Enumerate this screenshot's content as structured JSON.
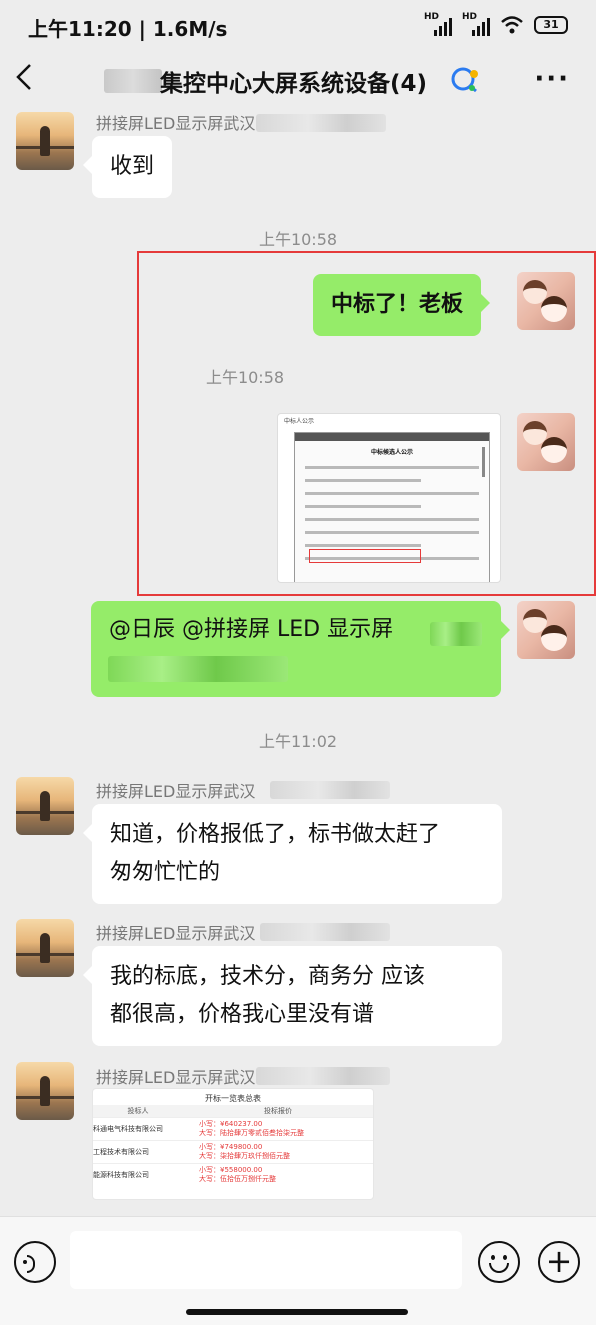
{
  "status_bar": {
    "time": "上午11:20 | 1.6M/s",
    "hd1": "HD",
    "hd2": "HD",
    "battery": "31"
  },
  "header": {
    "title": "集控中心大屏系统设备(4)",
    "back_icon": "back-arrow-icon",
    "more_icon": "more-dots-icon"
  },
  "messages": [
    {
      "type": "text",
      "direction": "in",
      "sender": "拼接屏LED显示屏武汉",
      "text": "收到"
    },
    {
      "type": "timestamp",
      "text": "上午10:58"
    },
    {
      "type": "text",
      "direction": "out",
      "text": "中标了！老板"
    },
    {
      "type": "timestamp",
      "text": "上午10:58"
    },
    {
      "type": "image",
      "direction": "out",
      "image_title": "中标候选人公示"
    },
    {
      "type": "text",
      "direction": "out",
      "text": "@日辰  @拼接屏 LED 显示屏"
    },
    {
      "type": "timestamp",
      "text": "上午11:02"
    },
    {
      "type": "text",
      "direction": "in",
      "sender": "拼接屏LED显示屏武汉",
      "lines": [
        "知道，价格报低了，标书做太赶了",
        "匆匆忙忙的"
      ]
    },
    {
      "type": "text",
      "direction": "in",
      "sender": "拼接屏LED显示屏武汉",
      "lines": [
        "我的标底，技术分，商务分 应该",
        "都很高，价格我心里没有谱"
      ]
    },
    {
      "type": "image",
      "direction": "in",
      "sender": "拼接屏LED显示屏武汉",
      "image_title": "开标一览表总表"
    }
  ],
  "table_image": {
    "title": "开标一览表总表",
    "headers": [
      "投标人",
      "投标报价"
    ],
    "rows": [
      {
        "bidder": "科通电气科技有限公司",
        "price_small": "小写：¥640237.00",
        "price_big": "大写：陆拾肆万零贰佰叁拾柒元整"
      },
      {
        "bidder": "工程技术有限公司",
        "price_small": "小写：¥749800.00",
        "price_big": "大写：柒拾肆万玖仟捌佰元整"
      },
      {
        "bidder": "能源科技有限公司",
        "price_small": "小写：¥558000.00",
        "price_big": "大写：伍拾伍万捌仟元整"
      }
    ]
  },
  "input_bar": {
    "placeholder": "",
    "voice_icon": "voice-icon",
    "emoji_icon": "emoji-icon",
    "plus_icon": "plus-icon"
  },
  "colors": {
    "background": "#ededed",
    "bubble_out": "#95ec69",
    "bubble_in": "#ffffff",
    "highlight_box": "#e53a3a"
  }
}
